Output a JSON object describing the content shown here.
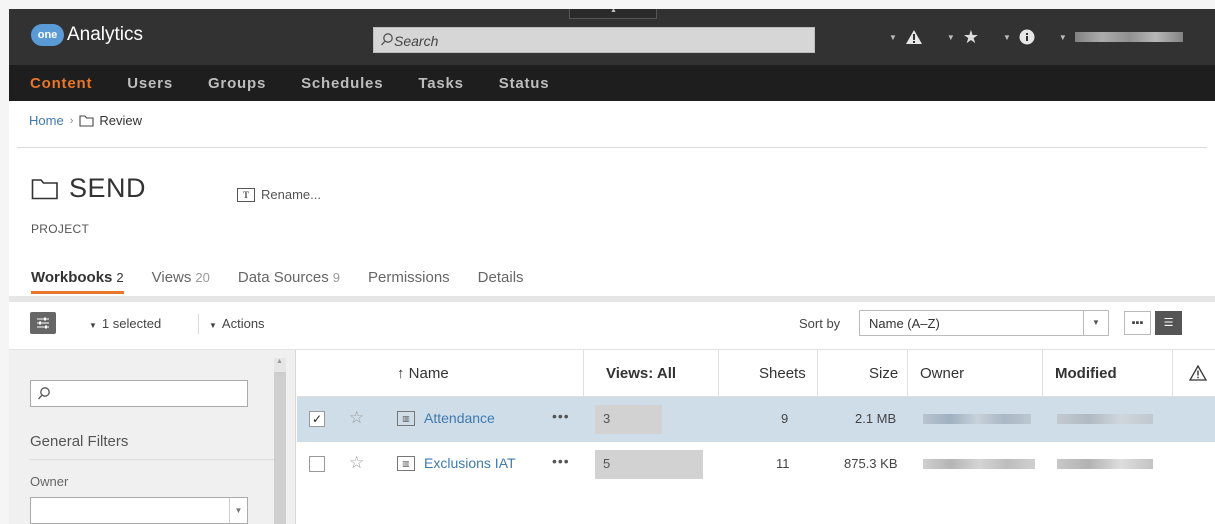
{
  "app": {
    "logo_badge": "one",
    "name": "Analytics"
  },
  "search": {
    "placeholder": "Search"
  },
  "top_icons": [
    "alert-icon",
    "star-icon",
    "info-icon",
    "user-menu"
  ],
  "nav": [
    "Content",
    "Users",
    "Groups",
    "Schedules",
    "Tasks",
    "Status"
  ],
  "breadcrumb": {
    "home": "Home",
    "separator": "›",
    "current": "Review"
  },
  "project": {
    "name": "SEND",
    "type": "PROJECT",
    "rename_label": "Rename..."
  },
  "tabs": [
    {
      "label": "Workbooks",
      "count": "2"
    },
    {
      "label": "Views",
      "count": "20"
    },
    {
      "label": "Data Sources",
      "count": "9"
    },
    {
      "label": "Permissions",
      "count": ""
    },
    {
      "label": "Details",
      "count": ""
    }
  ],
  "toolbar": {
    "selected_label": "1 selected",
    "actions_label": "Actions",
    "sort_label": "Sort by",
    "sort_value": "Name (A–Z)"
  },
  "filters": {
    "heading": "General Filters",
    "owner_label": "Owner",
    "owner_value": ""
  },
  "table": {
    "headers": {
      "name": "↑ Name",
      "views": "Views: All",
      "sheets": "Sheets",
      "size": "Size",
      "owner": "Owner",
      "modified": "Modified"
    },
    "rows": [
      {
        "name": "Attendance",
        "views": "3",
        "views_fraction": 0.62,
        "sheets": "9",
        "size": "2.1 MB",
        "selected": true
      },
      {
        "name": "Exclusions IAT",
        "views": "5",
        "views_fraction": 1.0,
        "sheets": "11",
        "size": "875.3 KB",
        "selected": false
      }
    ]
  },
  "colors": {
    "accent": "#e8762b",
    "topbar": "#323232",
    "nav": "#1e1e1e",
    "link": "#3f7ab0",
    "selected_row": "#cfdde9"
  }
}
